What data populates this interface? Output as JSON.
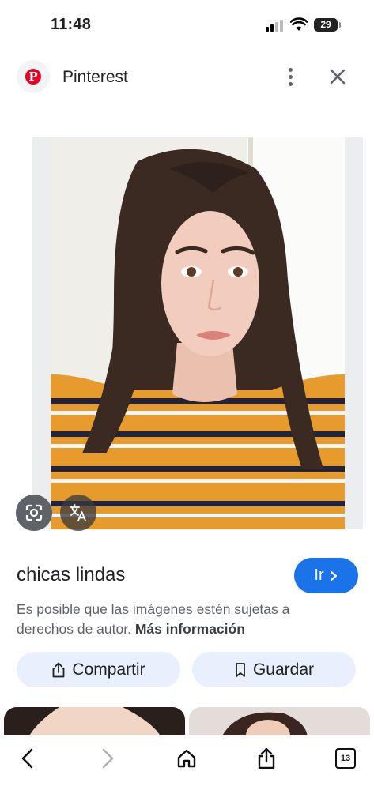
{
  "status_bar": {
    "time": "11:48",
    "battery": "29",
    "battery_level": 0.29,
    "icons": [
      "cellular-signal-icon",
      "wifi-icon",
      "battery-icon"
    ]
  },
  "header": {
    "site_name": "Pinterest",
    "logo_letter": "P",
    "brand_color": "#e60023",
    "icons": [
      "pinterest-logo-icon",
      "more-vert-icon",
      "close-icon"
    ]
  },
  "image_overlay": {
    "icons": [
      "google-lens-icon",
      "translate-icon"
    ]
  },
  "result": {
    "title": "chicas lindas",
    "go_button": "Ir",
    "go_button_color": "#1a73e8",
    "copyright_text": "Es posible que las imágenes estén sujetas a derechos de autor.",
    "more_info_link": "Más información"
  },
  "actions": {
    "share_label": "Compartir",
    "save_label": "Guardar",
    "icons": [
      "share-icon",
      "bookmark-icon"
    ]
  },
  "toolbar": {
    "tab_count": "13",
    "icons": [
      "back-arrow-icon",
      "forward-arrow-icon",
      "home-icon",
      "share-icon",
      "tabs-icon"
    ]
  }
}
